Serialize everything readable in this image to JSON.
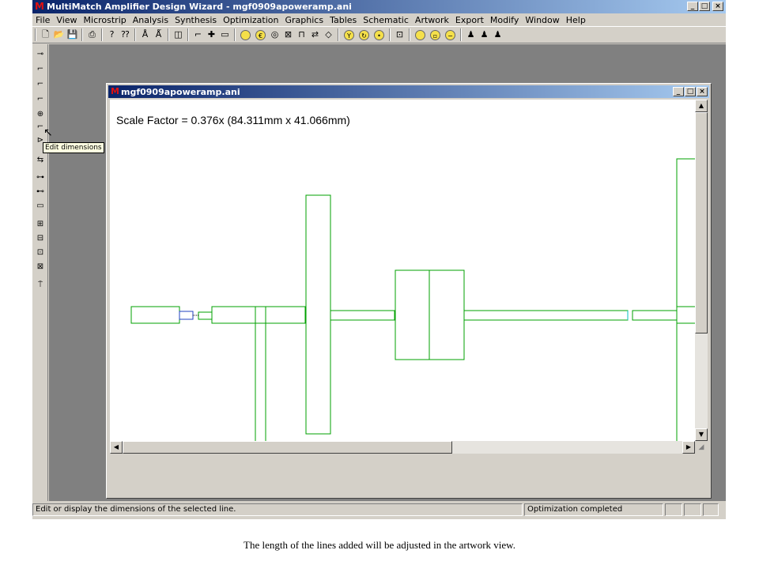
{
  "app": {
    "title": "MultiMatch Amplifier Design Wizard - mgf0909apoweramp.ani",
    "window_buttons": [
      "_",
      "□",
      "×"
    ]
  },
  "menu": [
    "File",
    "View",
    "Microstrip",
    "Analysis",
    "Synthesis",
    "Optimization",
    "Graphics",
    "Tables",
    "Schematic",
    "Artwork",
    "Export",
    "Modify",
    "Window",
    "Help"
  ],
  "child_window": {
    "title": "mgf0909apoweramp.ani",
    "scale_text": "Scale Factor =  0.376x (84.311mm x 41.066mm)"
  },
  "tooltip": "Edit dimensions",
  "status": {
    "left": "Edit or display the dimensions of the selected line.",
    "right": "Optimization completed"
  },
  "caption": "The length of the lines added will be adjusted in the artwork view.",
  "colors": {
    "artwork_line": "#00a000",
    "title_active": "#0a246a"
  },
  "icons": {
    "toolbar": [
      "new-file-icon",
      "open-folder-icon",
      "save-icon",
      "print-icon",
      "help-icon",
      "context-help-icon",
      "line-a-icon",
      "line-b-icon",
      "dim-icon",
      "bend-icon",
      "cross-icon",
      "box-icon",
      "circle-icon",
      "coin-icon",
      "ring-icon",
      "x-box-icon",
      "tee-icon",
      "equals-icon",
      "diamond-icon",
      "y-icon",
      "rotate-icon",
      "dot-icon",
      "frame-icon",
      "circle-b-icon",
      "square-icon",
      "minus-circle-icon",
      "person-a-icon",
      "person-b-icon",
      "person-c-icon"
    ],
    "vertical": [
      "vt-1-icon",
      "vt-2-icon",
      "vt-3-icon",
      "vt-4-icon",
      "vt-5-icon",
      "vt-6-icon",
      "vt-7-icon",
      "vt-8-icon",
      "vt-9-icon",
      "vt-10-icon",
      "vt-11-icon",
      "vt-12-icon",
      "vt-13-icon",
      "vt-14-icon",
      "vt-15-icon",
      "vt-16-icon"
    ]
  }
}
